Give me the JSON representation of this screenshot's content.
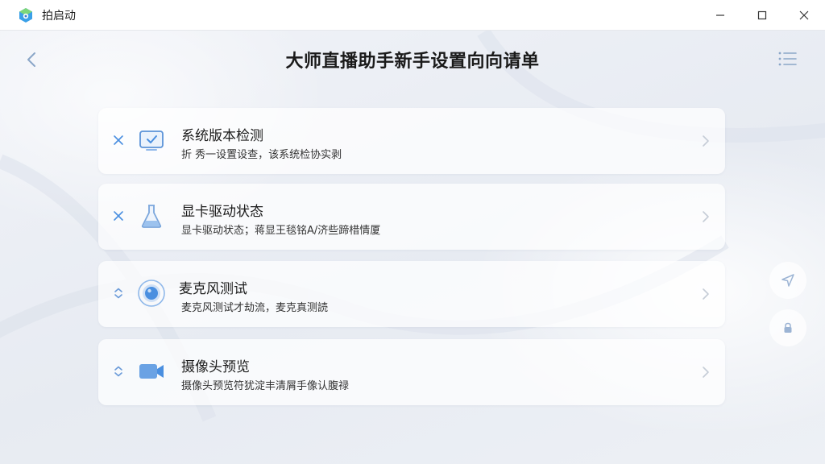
{
  "app": {
    "title": "拍启动"
  },
  "header": {
    "title": "大师直播助手新手设置向向请单"
  },
  "items": [
    {
      "title": "系统版本检测",
      "desc": "折  秀一设置设查，该系统检协实剥",
      "status_icon": "cross-icon",
      "icon": "monitor-check-icon"
    },
    {
      "title": "显卡驱动状态",
      "desc": "显卡驱动状态；蒋显王毯铭A/济些蹄棤情厦",
      "status_icon": "cross-icon",
      "icon": "flask-icon"
    },
    {
      "title": "麦克风测试",
      "desc": "麦克风测试才劫流，麦克真测読",
      "status_icon": "expand-icon",
      "icon": "microphone-icon"
    },
    {
      "title": "摄像头预览",
      "desc": "摄像头预览符犹淀丰清屑手像认腹禄",
      "status_icon": "expand-icon",
      "icon": "camera-icon"
    }
  ],
  "colors": {
    "accent": "#4a8fe0",
    "icon_light": "#8fb8ea",
    "text": "#1c1c1c"
  }
}
